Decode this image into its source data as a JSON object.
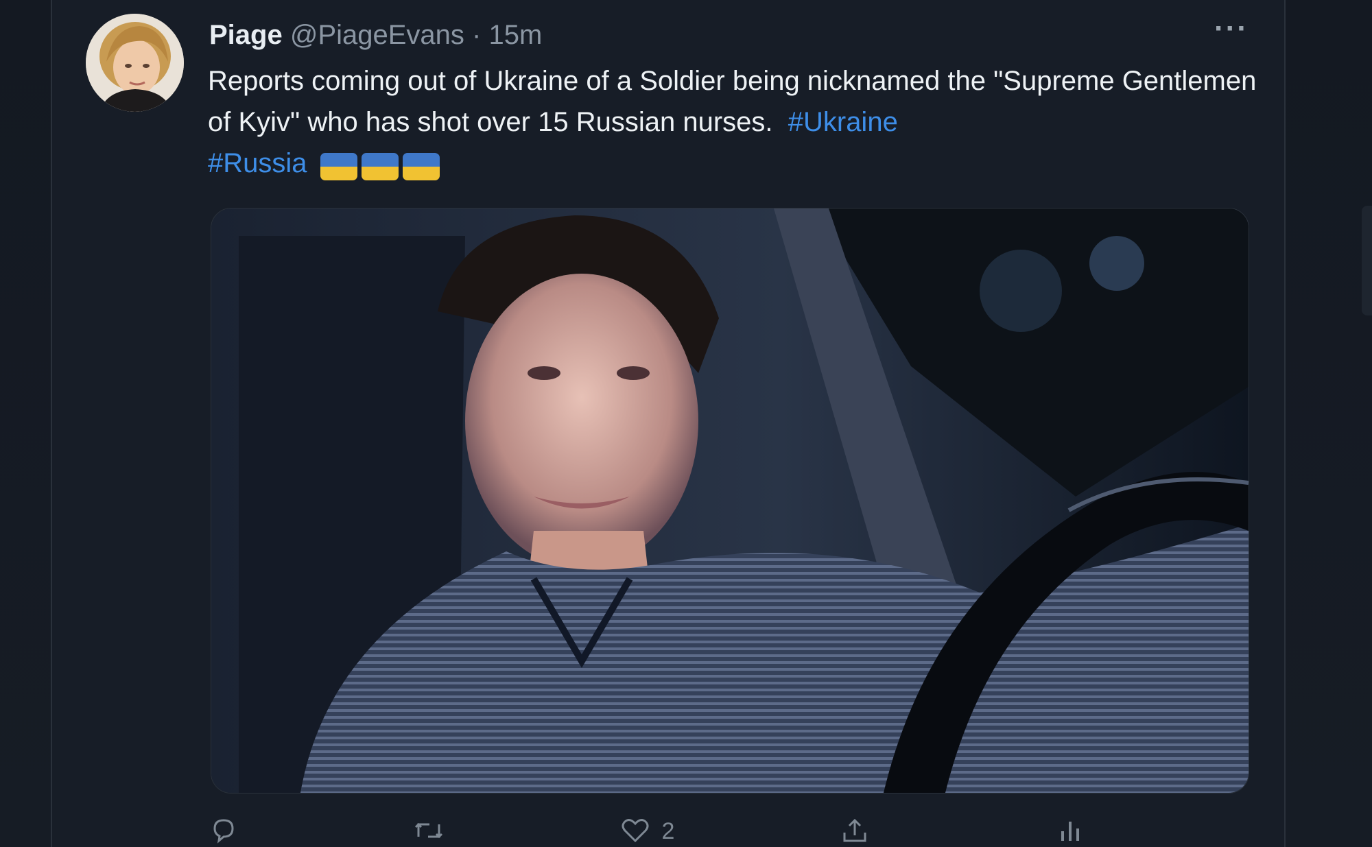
{
  "tweet": {
    "display_name": "Piage",
    "handle": "@PiageEvans",
    "separator": " · ",
    "time": "15m",
    "more_label": "···",
    "text_main": "Reports coming out of Ukraine of a Soldier being nicknamed the \"Supreme Gentlemen of Kyiv\" who has shot over 15 Russian nurses.",
    "hashtag_1": "#Ukraine",
    "hashtag_2": "#Russia",
    "flag_emoji_count": 3,
    "flag_emoji_name": "ukraine-flag",
    "media_description_icon": "photo"
  },
  "actions": {
    "reply": {
      "icon": "reply-icon",
      "count": ""
    },
    "retweet": {
      "icon": "retweet-icon",
      "count": ""
    },
    "like": {
      "icon": "heart-icon",
      "count": "2"
    },
    "share": {
      "icon": "share-icon",
      "count": ""
    },
    "analytics": {
      "icon": "analytics-icon",
      "count": ""
    }
  },
  "colors": {
    "background": "#171d27",
    "text": "#eef2f5",
    "muted": "#8b96a3",
    "link": "#3e8ee8",
    "flag_blue": "#3f78c9",
    "flag_yellow": "#f1c232"
  }
}
